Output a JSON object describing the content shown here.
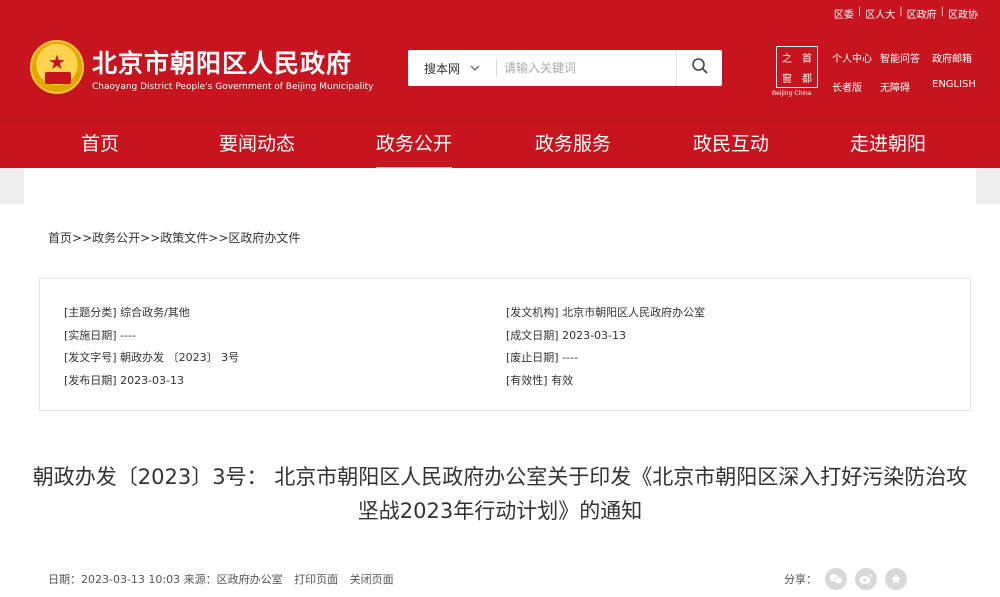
{
  "top_links": [
    "区委",
    "区人大",
    "区政府",
    "区政协"
  ],
  "site": {
    "title": "北京市朝阳区人民政府",
    "subtitle": "Chaoyang District People's Government of Beijing Municipality"
  },
  "search": {
    "scope": "搜本网",
    "placeholder": "请输入关键词"
  },
  "seal": {
    "chars": [
      "之",
      "首",
      "窗",
      "都"
    ],
    "caption": "Beijing·China"
  },
  "quick_links": [
    "个人中心",
    "智能问答",
    "政府邮箱",
    "长者版",
    "无障碍",
    "ENGLISH"
  ],
  "nav": [
    "首页",
    "要闻动态",
    "政务公开",
    "政务服务",
    "政民互动",
    "走进朝阳"
  ],
  "breadcrumb": [
    "首页",
    ">>",
    "政务公开",
    ">>",
    "政策文件",
    ">>",
    "区政府办文件"
  ],
  "meta": {
    "topic": "[主题分类] 综合政务/其他",
    "issuer": "[发文机构] 北京市朝阳区人民政府办公室",
    "effective": "[实施日期] ----",
    "created": "[成文日期] 2023-03-13",
    "doc_no": "[发文字号] 朝政办发 〔2023〕 3号",
    "abolished": "[废止日期] ----",
    "published": "[发布日期] 2023-03-13",
    "validity": "[有效性] 有效"
  },
  "title": "朝政办发〔2023〕3号： 北京市朝阳区人民政府办公室关于印发《北京市朝阳区深入打好污染防治攻坚战2023年行动计划》的通知",
  "footer": {
    "date": "日期：2023-03-13 10:03 来源：区政府办公室",
    "print": "打印页面",
    "close": "关闭页面",
    "share_label": "分享："
  },
  "colors": {
    "brand_red": "#c8141e"
  }
}
